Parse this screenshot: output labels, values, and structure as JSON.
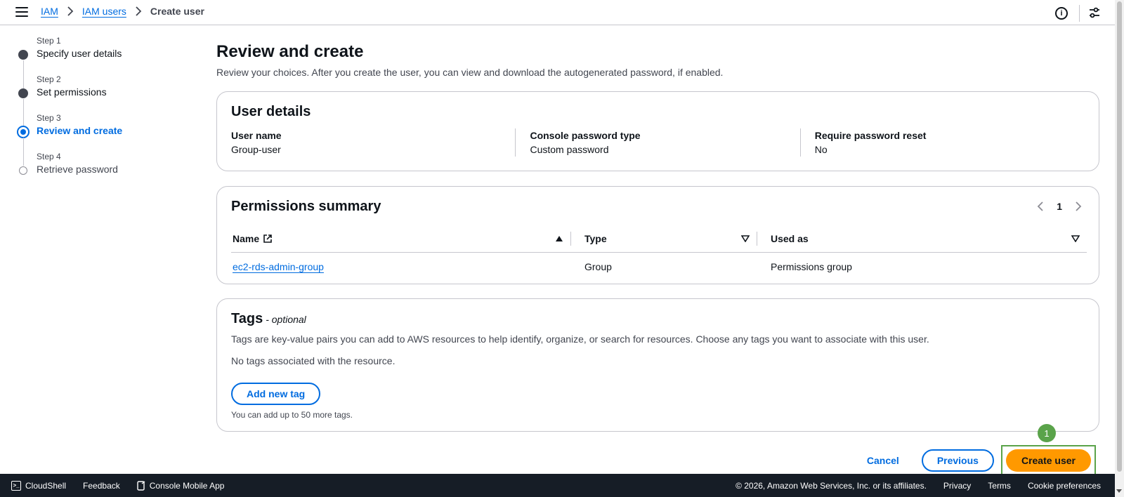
{
  "breadcrumb": {
    "items": [
      "IAM",
      "IAM users"
    ],
    "current": "Create user"
  },
  "steps": [
    {
      "num": "Step 1",
      "label": "Specify user details",
      "state": "done"
    },
    {
      "num": "Step 2",
      "label": "Set permissions",
      "state": "done"
    },
    {
      "num": "Step 3",
      "label": "Review and create",
      "state": "active"
    },
    {
      "num": "Step 4",
      "label": "Retrieve password",
      "state": "future"
    }
  ],
  "main": {
    "title": "Review and create",
    "description": "Review your choices. After you create the user, you can view and download the autogenerated password, if enabled."
  },
  "user_details": {
    "title": "User details",
    "fields": [
      {
        "key": "User name",
        "value": "Group-user"
      },
      {
        "key": "Console password type",
        "value": "Custom password"
      },
      {
        "key": "Require password reset",
        "value": "No"
      }
    ]
  },
  "permissions": {
    "title": "Permissions summary",
    "page": "1",
    "columns": [
      "Name",
      "Type",
      "Used as"
    ],
    "rows": [
      {
        "name": "ec2-rds-admin-group",
        "type": "Group",
        "used_as": "Permissions group"
      }
    ]
  },
  "tags": {
    "title": "Tags",
    "optional": "- optional",
    "description": "Tags are key-value pairs you can add to AWS resources to help identify, organize, or search for resources. Choose any tags you want to associate with this user.",
    "empty": "No tags associated with the resource.",
    "add_button": "Add new tag",
    "hint": "You can add up to 50 more tags."
  },
  "actions": {
    "cancel": "Cancel",
    "previous": "Previous",
    "create": "Create user",
    "marker": "1"
  },
  "footer": {
    "cloudshell": "CloudShell",
    "feedback": "Feedback",
    "mobile": "Console Mobile App",
    "copyright": "© 2026, Amazon Web Services, Inc. or its affiliates.",
    "privacy": "Privacy",
    "terms": "Terms",
    "cookies": "Cookie preferences"
  },
  "colors": {
    "accent": "#006ce0",
    "primary_button": "#ff9900",
    "footer_bg": "#161d26",
    "highlight": "#5aa34a"
  }
}
